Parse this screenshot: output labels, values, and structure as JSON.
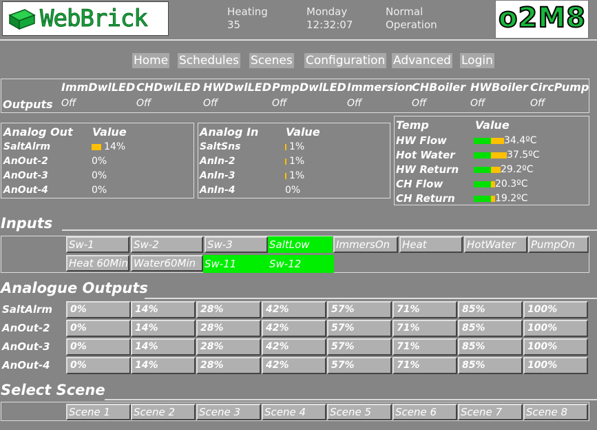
{
  "brand": {
    "logo_text": "WebBrick",
    "badge_text": "o2M8"
  },
  "header": {
    "status_label": "Heating",
    "status_value": "35",
    "day": "Monday",
    "time": "12:32:07",
    "mode_line1": "Normal",
    "mode_line2": "Operation"
  },
  "nav": [
    "Home",
    "Schedules",
    "Scenes",
    "Configuration",
    "Advanced",
    "Login"
  ],
  "outputs": {
    "label": "Outputs",
    "items": [
      {
        "name": "ImmDwlLED",
        "state": "Off"
      },
      {
        "name": "CHDwlLED",
        "state": "Off"
      },
      {
        "name": "HWDwlLED",
        "state": "Off"
      },
      {
        "name": "PmpDwlLED",
        "state": "Off"
      },
      {
        "name": "Immersion",
        "state": "Off"
      },
      {
        "name": "CHBoiler",
        "state": "Off"
      },
      {
        "name": "HWBoiler",
        "state": "Off"
      },
      {
        "name": "CircPump",
        "state": "Off"
      }
    ]
  },
  "analog_out": {
    "header_name": "Analog Out",
    "header_value": "Value",
    "rows": [
      {
        "name": "SaltAlrm",
        "value": "14%",
        "level": 0.14
      },
      {
        "name": "AnOut-2",
        "value": "0%",
        "level": 0
      },
      {
        "name": "AnOut-3",
        "value": "0%",
        "level": 0
      },
      {
        "name": "AnOut-4",
        "value": "0%",
        "level": 0
      }
    ]
  },
  "analog_in": {
    "header_name": "Analog In",
    "header_value": "Value",
    "rows": [
      {
        "name": "SaltSns",
        "value": "1%",
        "level": 0.01
      },
      {
        "name": "AnIn-2",
        "value": "1%",
        "level": 0.01
      },
      {
        "name": "AnIn-3",
        "value": "1%",
        "level": 0.01
      },
      {
        "name": "AnIn-4",
        "value": "0%",
        "level": 0
      }
    ]
  },
  "temps": {
    "header_name": "Temp",
    "header_value": "Value",
    "rows": [
      {
        "name": "HW Flow",
        "value": "34.4ºC"
      },
      {
        "name": "Hot Water",
        "value": "37.5ºC"
      },
      {
        "name": "HW Return",
        "value": "29.2ºC"
      },
      {
        "name": "CH Flow",
        "value": "20.3ºC"
      },
      {
        "name": "CH Return",
        "value": "19.2ºC"
      }
    ]
  },
  "inputs": {
    "title": "Inputs",
    "row1": [
      "Sw-1",
      "Sw-2",
      "Sw-3",
      "SaltLow",
      "ImmersOn",
      "Heat",
      "HotWater",
      "PumpOn"
    ],
    "row2": [
      "Heat 60Min",
      "Water60Min",
      "Sw-11",
      "Sw-12"
    ]
  },
  "analogue_outputs": {
    "title": "Analogue Outputs",
    "channels": [
      "SaltAlrm",
      "AnOut-2",
      "AnOut-3",
      "AnOut-4"
    ],
    "levels": [
      "0%",
      "14%",
      "28%",
      "42%",
      "57%",
      "71%",
      "85%",
      "100%"
    ]
  },
  "scenes": {
    "title": "Select Scene",
    "items": [
      "Scene 1",
      "Scene 2",
      "Scene 3",
      "Scene 4",
      "Scene 5",
      "Scene 6",
      "Scene 7",
      "Scene 8"
    ]
  },
  "colors": {
    "active": "#00ee00",
    "level_bar": "#ffc000",
    "temp_ok": "#00e000"
  }
}
